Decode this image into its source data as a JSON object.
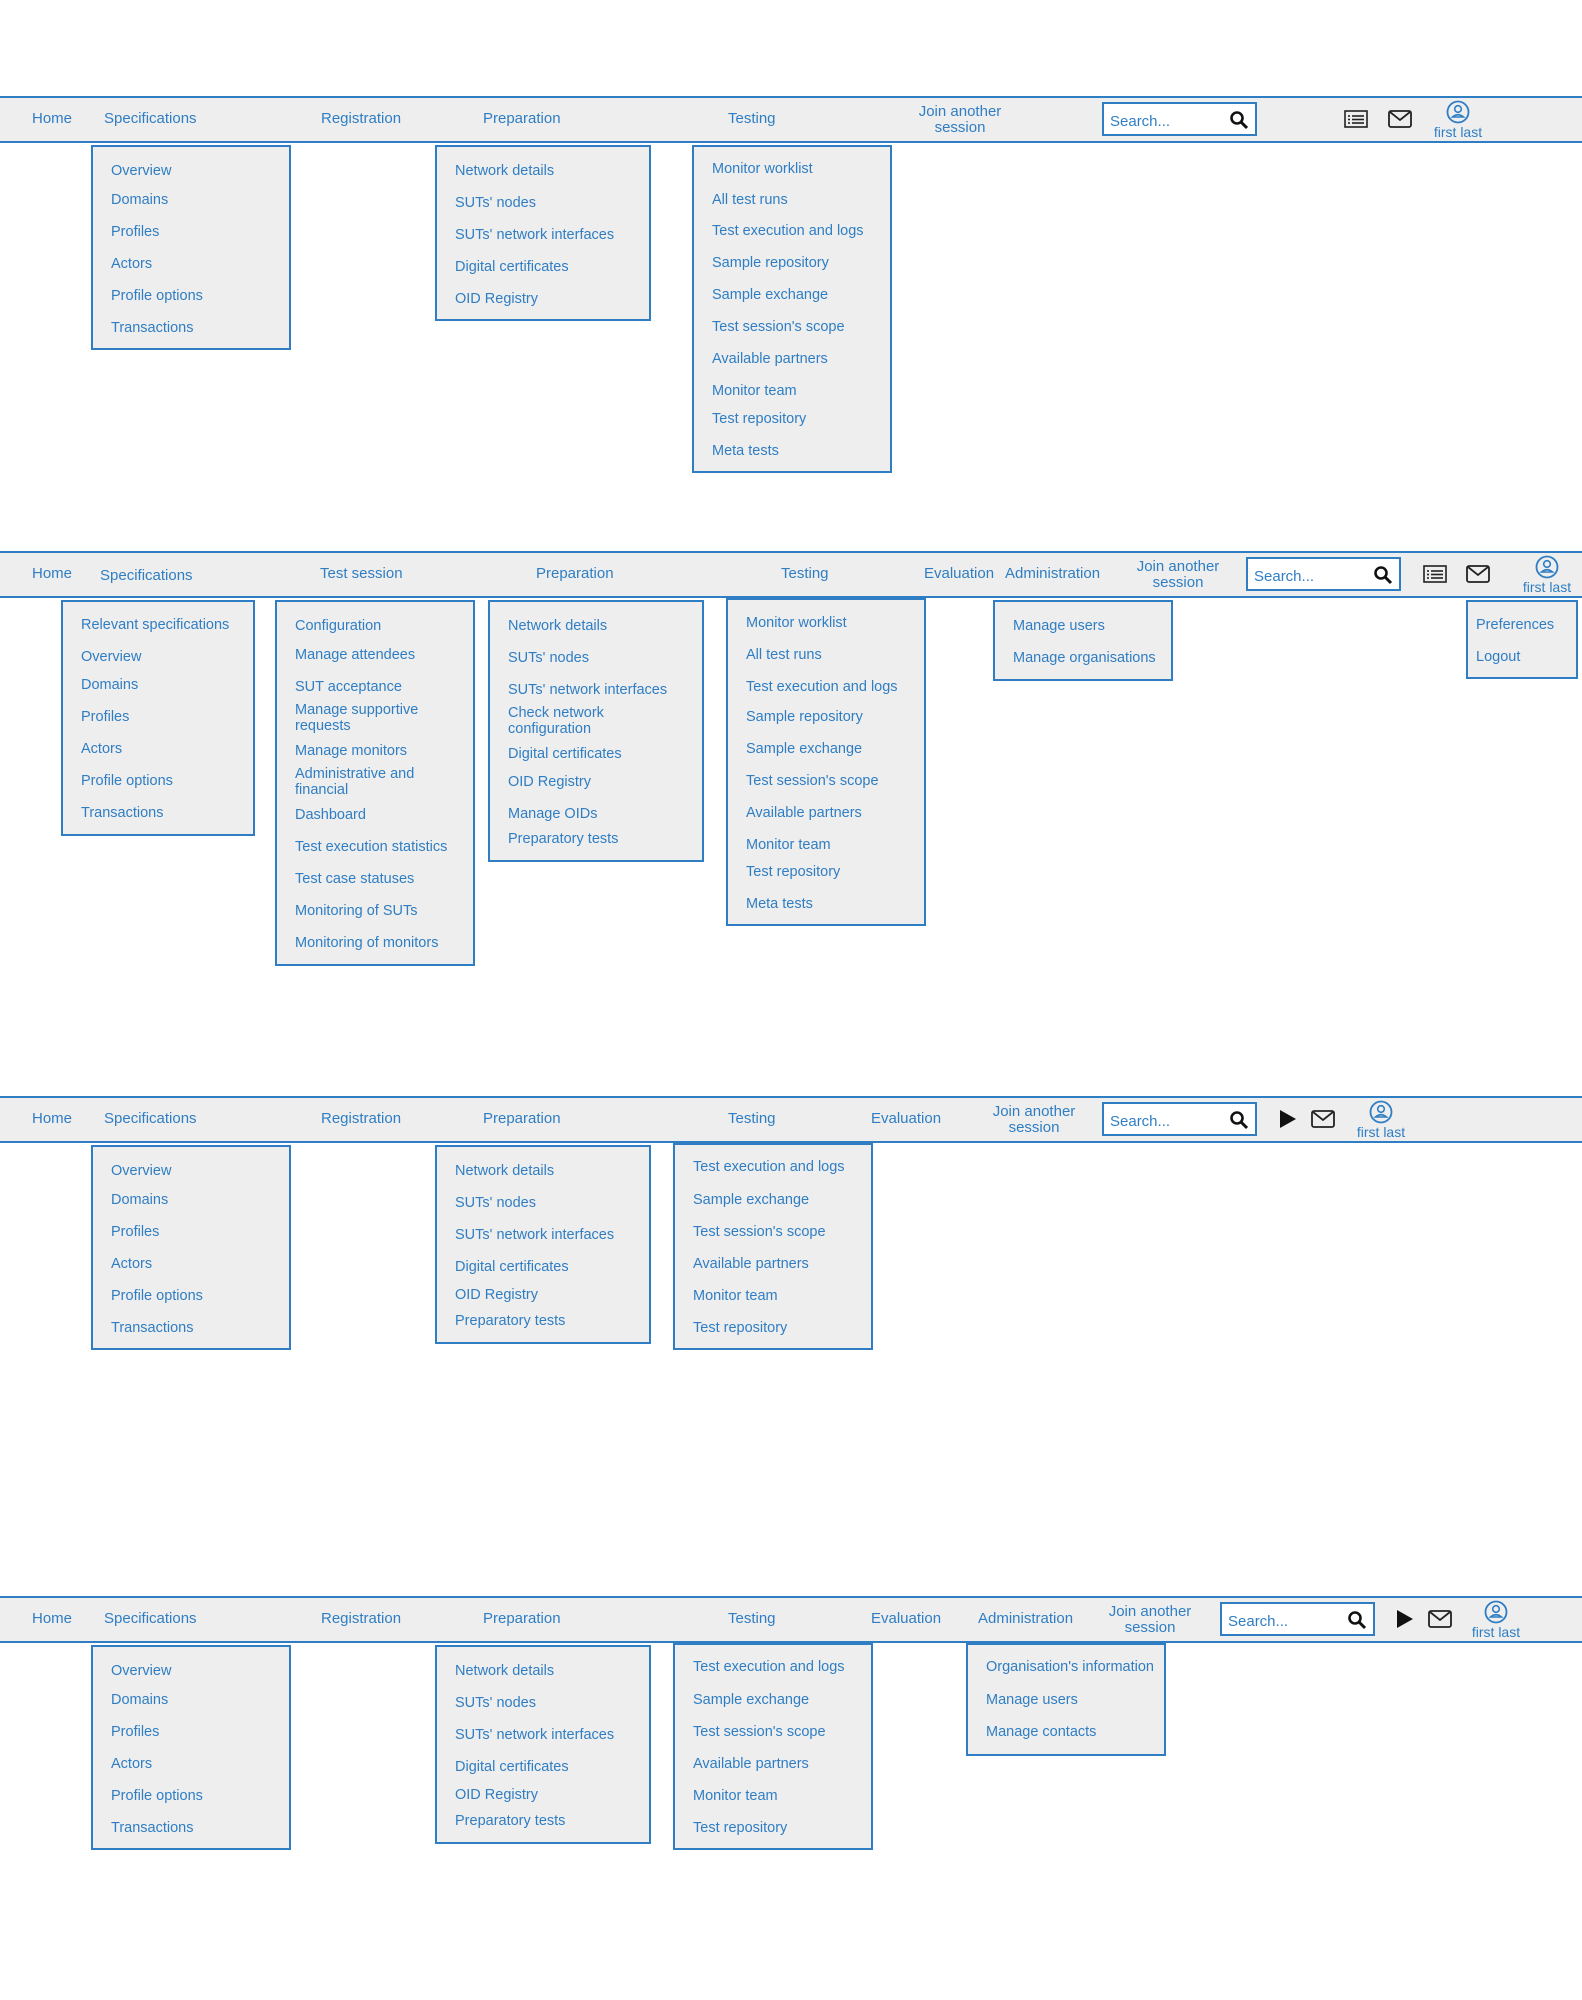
{
  "frame1": {
    "nav": {
      "home": "Home",
      "specifications": "Specifications",
      "registration": "Registration",
      "preparation": "Preparation",
      "testing": "Testing",
      "join": "Join another session"
    },
    "search_placeholder": "Search...",
    "user": "first last",
    "specifications_menu": [
      "Overview",
      "Domains",
      "Profiles",
      "Actors",
      "Profile options",
      "Transactions"
    ],
    "preparation_menu": [
      "Network details",
      "SUTs' nodes",
      "SUTs' network interfaces",
      "Digital certificates",
      "OID Registry"
    ],
    "testing_menu": [
      "Monitor worklist",
      "All test runs",
      "Test execution and logs",
      "Sample repository",
      "Sample exchange",
      "Test session's scope",
      "Available partners",
      "Monitor team",
      "Test repository",
      "Meta tests"
    ]
  },
  "frame2": {
    "nav": {
      "home": "Home",
      "specifications": "Specifications",
      "test_session": "Test session",
      "preparation": "Preparation",
      "testing": "Testing",
      "evaluation": "Evaluation",
      "administration": "Administration",
      "join": "Join another session"
    },
    "search_placeholder": "Search...",
    "user": "first last",
    "specifications_menu": [
      "Relevant specifications",
      "Overview",
      "Domains",
      "Profiles",
      "Actors",
      "Profile options",
      "Transactions"
    ],
    "test_session_menu": [
      "Configuration",
      "Manage attendees",
      "SUT acceptance",
      "Manage supportive requests",
      "Manage monitors",
      "Administrative and financial",
      "Dashboard",
      "Test execution statistics",
      "Test case statuses",
      "Monitoring of SUTs",
      "Monitoring of monitors"
    ],
    "preparation_menu": [
      "Network details",
      "SUTs' nodes",
      "SUTs' network interfaces",
      "Check network configuration",
      "Digital certificates",
      "OID Registry",
      "Manage OIDs",
      "Preparatory tests"
    ],
    "testing_menu": [
      "Monitor worklist",
      "All test runs",
      "Test execution and logs",
      "Sample repository",
      "Sample exchange",
      "Test session's scope",
      "Available partners",
      "Monitor team",
      "Test repository",
      "Meta tests"
    ],
    "administration_menu": [
      "Manage users",
      "Manage organisations"
    ],
    "user_menu": [
      "Preferences",
      "Logout"
    ]
  },
  "frame3": {
    "nav": {
      "home": "Home",
      "specifications": "Specifications",
      "registration": "Registration",
      "preparation": "Preparation",
      "testing": "Testing",
      "evaluation": "Evaluation",
      "join": "Join another session"
    },
    "search_placeholder": "Search...",
    "user": "first last",
    "specifications_menu": [
      "Overview",
      "Domains",
      "Profiles",
      "Actors",
      "Profile options",
      "Transactions"
    ],
    "preparation_menu": [
      "Network details",
      "SUTs' nodes",
      "SUTs' network interfaces",
      "Digital certificates",
      "OID Registry",
      "Preparatory tests"
    ],
    "testing_menu": [
      "Test execution and logs",
      "Sample exchange",
      "Test session's scope",
      "Available partners",
      "Monitor team",
      "Test repository"
    ]
  },
  "frame4": {
    "nav": {
      "home": "Home",
      "specifications": "Specifications",
      "registration": "Registration",
      "preparation": "Preparation",
      "testing": "Testing",
      "evaluation": "Evaluation",
      "administration": "Administration",
      "join": "Join another session"
    },
    "search_placeholder": "Search...",
    "user": "first last",
    "specifications_menu": [
      "Overview",
      "Domains",
      "Profiles",
      "Actors",
      "Profile options",
      "Transactions"
    ],
    "preparation_menu": [
      "Network details",
      "SUTs' nodes",
      "SUTs' network interfaces",
      "Digital certificates",
      "OID Registry",
      "Preparatory tests"
    ],
    "testing_menu": [
      "Test execution and logs",
      "Sample exchange",
      "Test session's scope",
      "Available partners",
      "Monitor team",
      "Test repository"
    ],
    "administration_menu": [
      "Organisation's information",
      "Manage users",
      "Manage contacts"
    ]
  }
}
